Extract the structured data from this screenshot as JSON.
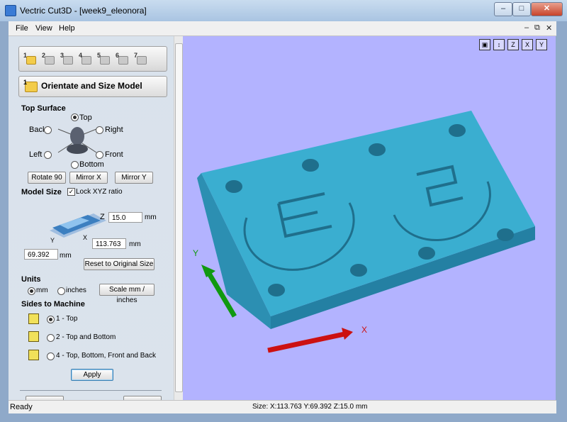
{
  "window": {
    "title": "Vectric Cut3D - [week9_eleonora]",
    "min": "–",
    "max": "□",
    "close": "✕"
  },
  "menu": {
    "items": [
      "File",
      "View",
      "Help"
    ],
    "mdi": {
      "min": "–",
      "restore": "⧉",
      "close": "✕"
    }
  },
  "steps": [
    "1",
    "2",
    "3",
    "4",
    "5",
    "6",
    "7"
  ],
  "panel": {
    "step_number": "1",
    "title": "Orientate and Size Model",
    "top_surface": {
      "heading": "Top Surface",
      "options": {
        "top": "Top",
        "back": "Back",
        "right": "Right",
        "left": "Left",
        "front": "Front",
        "bottom": "Bottom"
      },
      "selected": "Top"
    },
    "rotate_label": "Rotate 90",
    "mirror_x_label": "Mirror X",
    "mirror_y_label": "Mirror Y",
    "model_size": {
      "heading": "Model Size",
      "lock_label": "Lock XYZ ratio",
      "lock_checked": true,
      "z_value": "15.0",
      "x_value": "113.763",
      "y_value": "69.392",
      "unit": "mm",
      "axis_z": "Z",
      "axis_x": "X",
      "axis_y": "Y",
      "reset_label": "Reset to Original Size"
    },
    "units": {
      "heading": "Units",
      "mm": "mm",
      "inches": "inches",
      "selected": "mm",
      "scale_label": "Scale mm / inches"
    },
    "sides": {
      "heading": "Sides to Machine",
      "options": [
        "1 - Top",
        "2 - Top and Bottom",
        "4 - Top, Bottom, Front and Back"
      ],
      "selected": 0,
      "apply_label": "Apply"
    }
  },
  "viewport": {
    "toolbar_icons": [
      "fit-view-icon",
      "iso-view-icon",
      "z-view-icon",
      "x-view-icon",
      "y-view-icon"
    ],
    "toolbar_labels": [
      "▣",
      "↕",
      "Z",
      "X",
      "Y"
    ],
    "axis_x": "X",
    "axis_y": "Y",
    "background": "#b3b3ff",
    "model_color": "#3aaed0",
    "x_arrow_color": "#cc1111",
    "y_arrow_color": "#109910"
  },
  "status": {
    "left": "Ready",
    "center": "Size: X:113.763 Y:69.392 Z:15.0 mm"
  }
}
